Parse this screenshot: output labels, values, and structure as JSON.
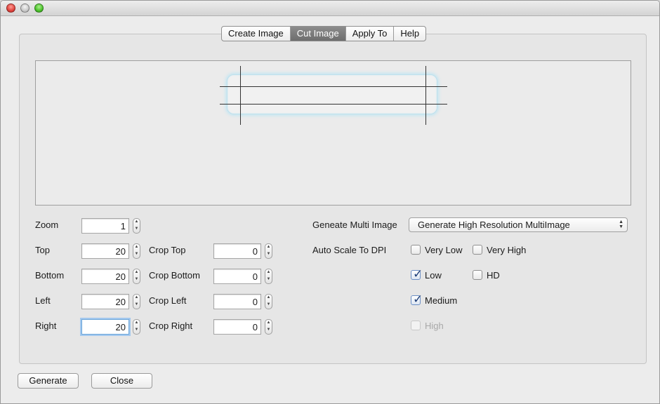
{
  "tabs": [
    "Create Image",
    "Cut Image",
    "Apply To",
    "Help"
  ],
  "active_tab": "Cut Image",
  "form": {
    "zoom": {
      "label": "Zoom",
      "value": "1"
    },
    "top": {
      "label": "Top",
      "value": "20"
    },
    "bottom": {
      "label": "Bottom",
      "value": "20"
    },
    "left": {
      "label": "Left",
      "value": "20"
    },
    "right": {
      "label": "Right",
      "value": "20"
    },
    "crop_top": {
      "label": "Crop Top",
      "value": "0"
    },
    "crop_bottom": {
      "label": "Crop Bottom",
      "value": "0"
    },
    "crop_left": {
      "label": "Crop Left",
      "value": "0"
    },
    "crop_right": {
      "label": "Crop Right",
      "value": "0"
    }
  },
  "multi_image": {
    "label": "Geneate Multi Image",
    "selected": "Generate High Resolution MultiImage"
  },
  "dpi": {
    "label": "Auto Scale To DPI",
    "options": {
      "very_low": {
        "label": "Very Low",
        "checked": false,
        "enabled": true
      },
      "very_high": {
        "label": "Very High",
        "checked": false,
        "enabled": true
      },
      "low": {
        "label": "Low",
        "checked": true,
        "enabled": true
      },
      "hd": {
        "label": "HD",
        "checked": false,
        "enabled": true
      },
      "medium": {
        "label": "Medium",
        "checked": true,
        "enabled": true
      },
      "high": {
        "label": "High",
        "checked": false,
        "enabled": false
      }
    }
  },
  "buttons": {
    "generate": "Generate",
    "close": "Close"
  },
  "icons": {
    "check": "checkmark-icon",
    "stepper": "stepper-arrows-icon",
    "combo": "updown-arrows-icon"
  }
}
